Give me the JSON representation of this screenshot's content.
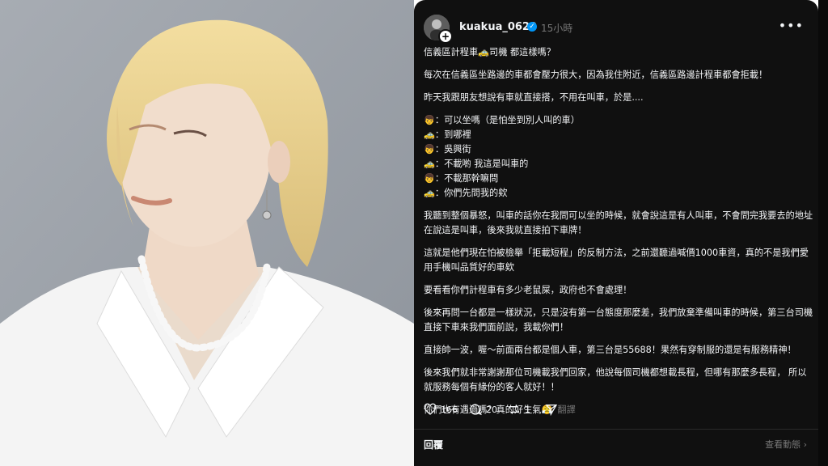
{
  "post": {
    "username": "kuakua_0629",
    "time": "15小時",
    "more_icon": "more-icon",
    "paragraphs": [
      "信義區計程車🚕司機 都這樣嗎？",
      "每次在信義區坐路邊的車都會壓力很大，因為我住附近，信義區路邊計程車都會拒載！",
      "昨天我跟朋友想說有車就直接搭，不用在叫車，於是...."
    ],
    "dialogue": [
      "👦：可以坐嗎（是怕坐到別人叫的車）",
      "🚕：到哪裡",
      "👦：吳興街",
      "🚕：不載喲 我這是叫車的",
      "👦：不載那幹嘛問",
      "🚕：你們先問我的欸"
    ],
    "paragraphs2": [
      "我聽到整個暴怒，叫車的話你在我問可以坐的時候，就會說這是有人叫車，不會問完我要去的地址在說這是叫車，後來我就直接拍下車牌！",
      "這就是他們現在怕被檢舉「拒載短程」的反制方法，之前還聽過喊價1000車資，真的不是我們愛用手機叫品質好的車欸",
      "要看看你們計程車有多少老鼠屎，政府也不會處理！",
      "後來再問一台都是一樣狀況，只是沒有第一台態度那麼差，我們放棄準備叫車的時候，第三台司機直接下車來我們面前說，我載你們！",
      "直接帥一波，喔～前面兩台都是個人車，第三台是55688！果然有穿制服的還是有服務精神！",
      "後來我們就非常謝謝那位司機載我們回家，他說每個司機都想載長程，但哪有那麼多長程， 所以就服務每個有緣份的客人就好！！"
    ],
    "last_line": "你們也有遇過嗎？真的好生氣😤",
    "translate": "翻譯",
    "likes": "166",
    "comments": "20",
    "reposts": "1",
    "reply_label": "回覆",
    "activity_label": "查看動態",
    "colors": {
      "bg": "#101010",
      "text": "#f3f5f7",
      "muted": "#777777",
      "verified": "#0095f6"
    }
  }
}
